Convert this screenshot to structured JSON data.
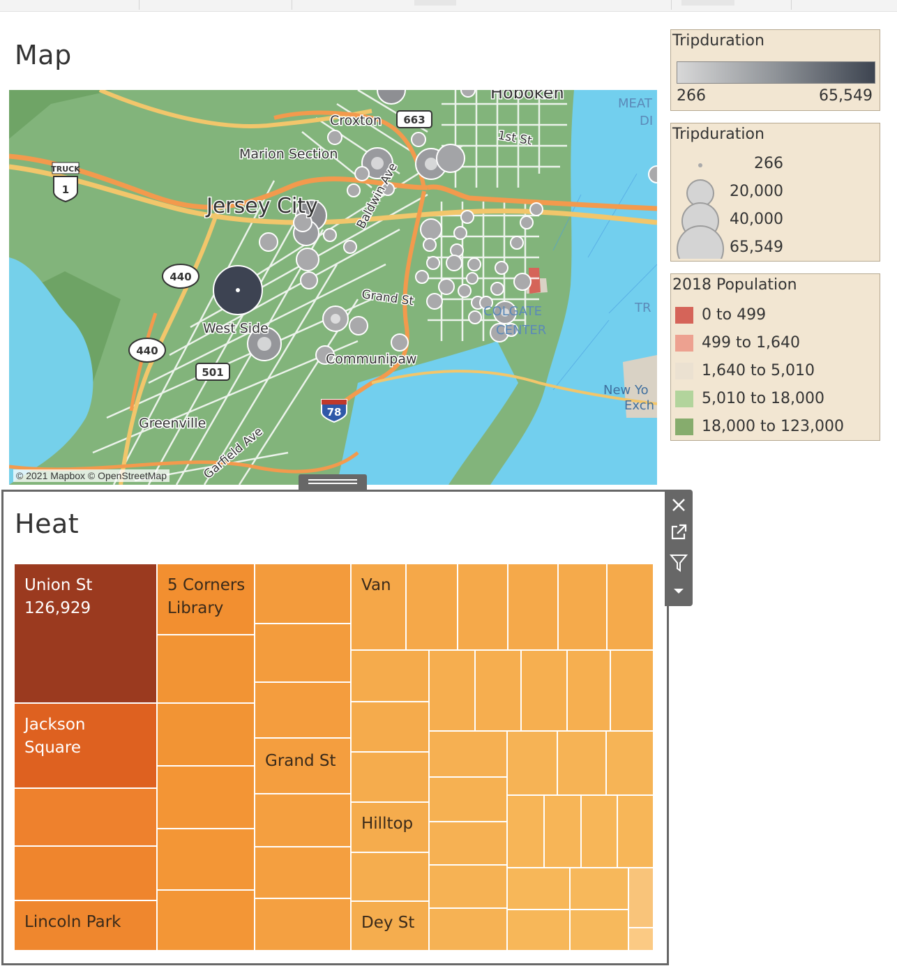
{
  "map_section": {
    "title": "Map",
    "attribution": "© 2021 Mapbox © OpenStreetMap",
    "labels": {
      "hoboken": "Hoboken",
      "croxton": "Croxton",
      "route_663": "663",
      "first_st": "1st St",
      "marion": "Marion Section",
      "truck": "TRUCK",
      "us1": "1",
      "jersey_city": "Jersey City",
      "baldwin": "Baldwin Ave",
      "route_440a": "440",
      "route_440b": "440",
      "grand_st": "Grand St",
      "west_side": "West Side",
      "communipaw": "Communipaw",
      "route_501": "501",
      "i78": "78",
      "greenville": "Greenville",
      "garfield": "Garfield Ave",
      "meat": "MEAT",
      "di": "DI",
      "colgate": "COLGATE",
      "center": "CENTER",
      "tr": "TR",
      "new_york": "New Yo",
      "exch": "Exch"
    }
  },
  "legend_color": {
    "title": "Tripduration",
    "min": "266",
    "max": "65,549"
  },
  "legend_size": {
    "title": "Tripduration",
    "items": [
      "266",
      "20,000",
      "40,000",
      "65,549"
    ]
  },
  "legend_population": {
    "title": "2018 Population",
    "items": [
      {
        "label": "0 to 499",
        "color": "#d56459"
      },
      {
        "label": "499 to 1,640",
        "color": "#eda190"
      },
      {
        "label": "1,640 to 5,010",
        "color": "#ebe1d1"
      },
      {
        "label": "5,010 to 18,000",
        "color": "#b2d49c"
      },
      {
        "label": "18,000 to 123,000",
        "color": "#86ac6d"
      }
    ]
  },
  "heat_section": {
    "title": "Heat",
    "labels": {
      "union_st": "Union St\n126,929",
      "five_corners": "5 Corners\nLibrary",
      "van": "Van",
      "jackson": "Jackson\nSquare",
      "grand_st": "Grand St",
      "hilltop": "Hilltop",
      "lincoln": "Lincoln Park",
      "dey_st": "Dey St"
    }
  },
  "toolbar": {
    "close": "close-icon",
    "open": "external-link-icon",
    "filter": "filter-icon",
    "more": "caret-down-icon"
  }
}
